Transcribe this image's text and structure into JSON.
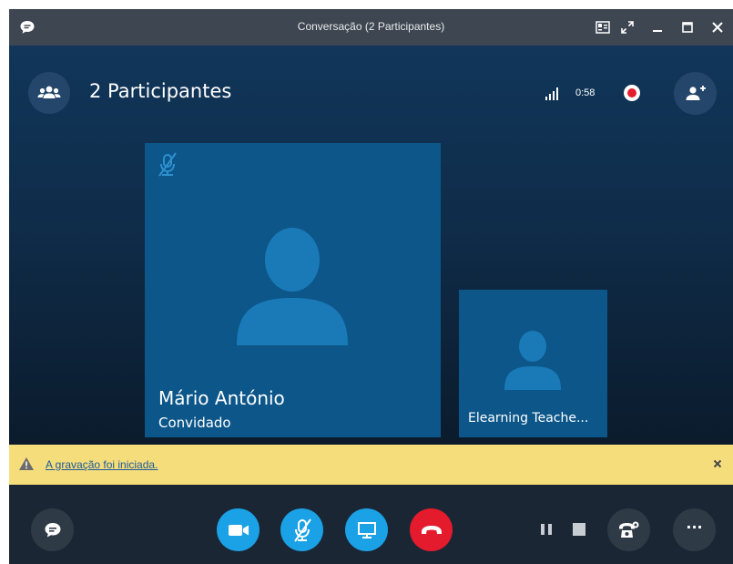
{
  "window": {
    "title": "Conversação (2 Participantes)"
  },
  "header": {
    "participants_label": "2 Participantes",
    "call_duration": "0:58"
  },
  "participants": [
    {
      "name": "Mário António",
      "role": "Convidado",
      "muted": true
    },
    {
      "name": "Elearning Teache..."
    }
  ],
  "notification": {
    "text": "A gravação foi iniciada.",
    "close_glyph": "×"
  },
  "toolbar": {
    "more_label": "···"
  },
  "colors": {
    "accent": "#1aa1e6",
    "hangup": "#e41b2c",
    "tile": "#0c5689",
    "avatar": "#1a7ab8",
    "notice_bg": "#f5dd7b",
    "recording": "#e21e2e"
  },
  "icons": [
    "chat-bubble-icon",
    "compact-view-icon",
    "fullscreen-icon",
    "minimize-icon",
    "maximize-icon",
    "close-icon",
    "participants-icon",
    "signal-icon",
    "record-icon",
    "add-person-icon",
    "muted-mic-icon",
    "person-avatar-icon",
    "warning-icon",
    "video-camera-icon",
    "mic-off-icon",
    "present-screen-icon",
    "hang-up-icon",
    "pause-icon",
    "stop-icon",
    "call-controls-icon",
    "more-icon"
  ]
}
